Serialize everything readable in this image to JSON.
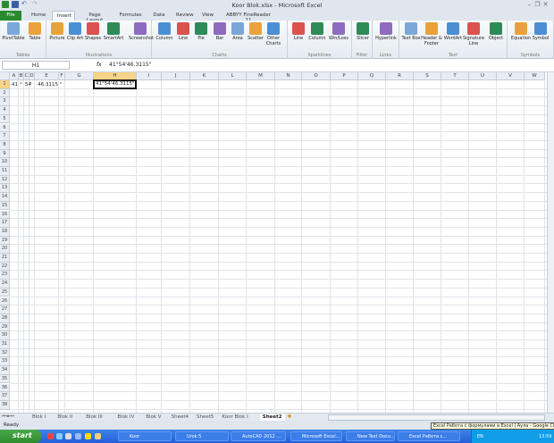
{
  "window": {
    "title": "Koor Blok.xlsx - Microsoft Excel"
  },
  "ribbon_tabs": [
    "File",
    "Home",
    "Insert",
    "Page Layout",
    "Formulas",
    "Data",
    "Review",
    "View",
    "ABBYY FineReader 11"
  ],
  "active_tab": "Insert",
  "groups": [
    {
      "label": "Tables",
      "buttons": [
        "PivotTable",
        "Table"
      ]
    },
    {
      "label": "Illustrations",
      "buttons": [
        "Picture",
        "Clip Art",
        "Shapes",
        "SmartArt",
        "Screenshot"
      ]
    },
    {
      "label": "Charts",
      "buttons": [
        "Column",
        "Line",
        "Pie",
        "Bar",
        "Area",
        "Scatter",
        "Other Charts"
      ]
    },
    {
      "label": "Sparklines",
      "buttons": [
        "Line",
        "Column",
        "Win/Loss"
      ]
    },
    {
      "label": "Filter",
      "buttons": [
        "Slicer"
      ]
    },
    {
      "label": "Links",
      "buttons": [
        "Hyperlink"
      ]
    },
    {
      "label": "Text",
      "buttons": [
        "Text Box",
        "Header & Footer",
        "WordArt",
        "Signature Line",
        "Object"
      ]
    },
    {
      "label": "Symbols",
      "buttons": [
        "Equation",
        "Symbol"
      ]
    }
  ],
  "formula_bar": {
    "name_box": "H1",
    "fx": "fx",
    "value": "41°54'46.3115\""
  },
  "columns": [
    "A",
    "B",
    "C",
    "D",
    "E",
    "F",
    "G",
    "H",
    "I",
    "J",
    "K",
    "L",
    "M",
    "N",
    "O",
    "P",
    "Q",
    "R",
    "S",
    "T",
    "U",
    "V",
    "W"
  ],
  "rows": [
    "1",
    "2",
    "3",
    "4",
    "5",
    "6",
    "7",
    "8",
    "9",
    "10",
    "11",
    "12",
    "13",
    "14",
    "15",
    "16",
    "17",
    "18",
    "19",
    "20",
    "21",
    "22",
    "23",
    "24",
    "25",
    "26",
    "27",
    "28",
    "29",
    "30",
    "31",
    "32",
    "33",
    "34",
    "35",
    "36",
    "37",
    "38"
  ],
  "selected_cell": "H1",
  "row1": {
    "A": "41",
    "B": "°",
    "C": "54",
    "D": "'",
    "E": "46.3115",
    "F": "\"",
    "H": "41°54'46.3115\""
  },
  "sheets": [
    "Blok I",
    "Blok II",
    "Blok III",
    "Blok IV",
    "Blok V",
    "Sheet4",
    "Sheet5",
    "Koor Blok I",
    "Sheet2"
  ],
  "active_sheet": "Sheet2",
  "status": "Ready",
  "tooltip": "Excel Работа с формулами в Excel | Аула - Google Chrome",
  "taskbar": {
    "start": "start",
    "tasks": [
      "Koor",
      "Urok 5",
      "AutoCAD 2012 ...",
      "Microsoft Excel...",
      "New Text Docu...",
      "Excel Работа с..."
    ],
    "lang": "EN",
    "clock": "13:59"
  },
  "colors": {
    "file_tab": "#2a8a2e",
    "selection_header": "#f8d48a",
    "taskbar": "#245edb",
    "start": "#2e8b2e"
  }
}
